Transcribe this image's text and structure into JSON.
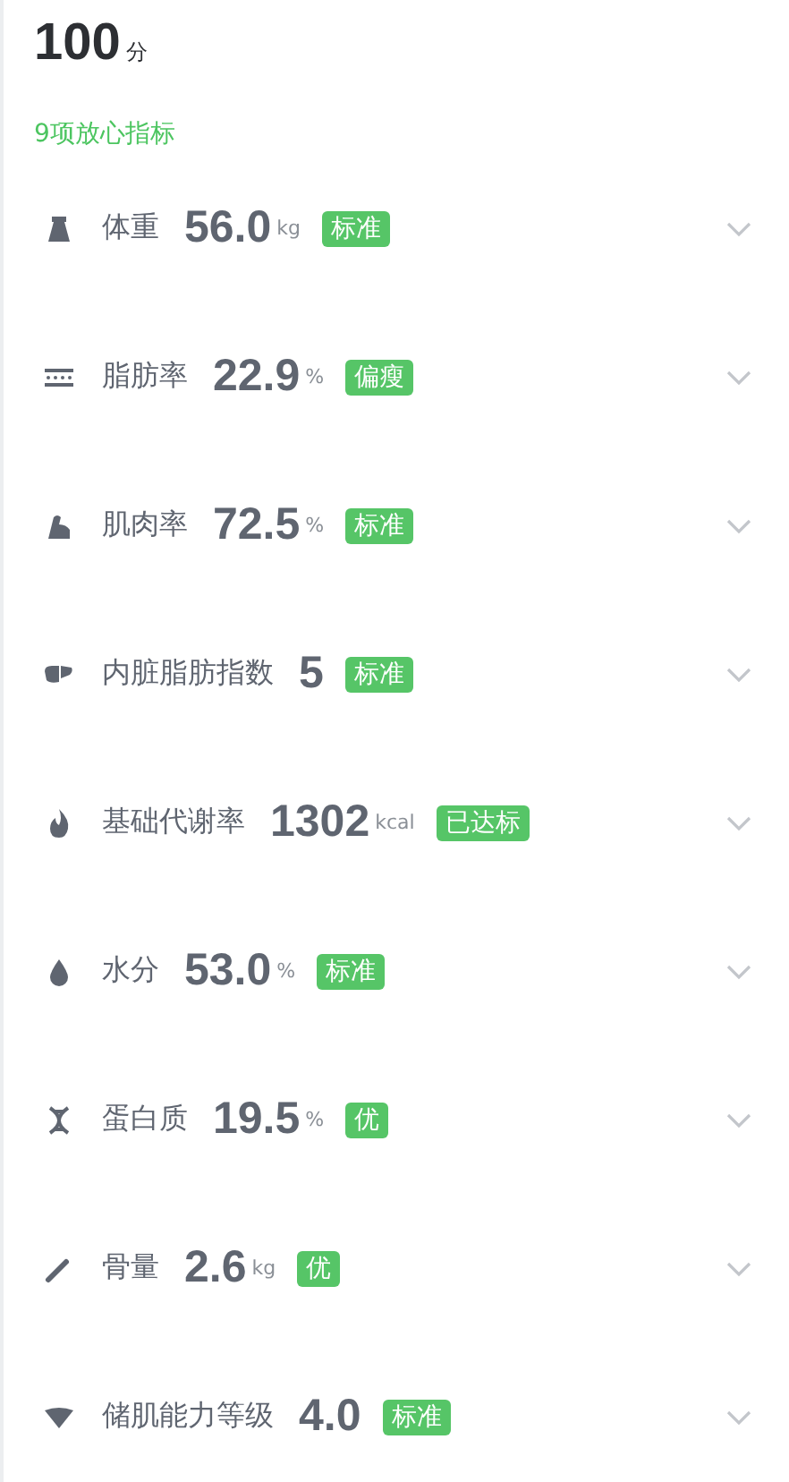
{
  "score": {
    "value": "100",
    "unit": "分"
  },
  "summary": "9项放心指标",
  "metrics": [
    {
      "name": "体重",
      "value": "56.0",
      "unit": "kg",
      "tag": "标准"
    },
    {
      "name": "脂肪率",
      "value": "22.9",
      "unit": "%",
      "tag": "偏瘦"
    },
    {
      "name": "肌肉率",
      "value": "72.5",
      "unit": "%",
      "tag": "标准"
    },
    {
      "name": "内脏脂肪指数",
      "value": "5",
      "tag": "标准"
    },
    {
      "name": "基础代谢率",
      "value": "1302",
      "unit": "kcal",
      "tag": "已达标"
    },
    {
      "name": "水分",
      "value": "53.0",
      "unit": "%",
      "tag": "标准"
    },
    {
      "name": "蛋白质",
      "value": "19.5",
      "unit": "%",
      "tag": "优"
    },
    {
      "name": "骨量",
      "value": "2.6",
      "unit": "kg",
      "tag": "优"
    },
    {
      "name": "储肌能力等级",
      "value": "4.0",
      "tag": "标准"
    }
  ]
}
